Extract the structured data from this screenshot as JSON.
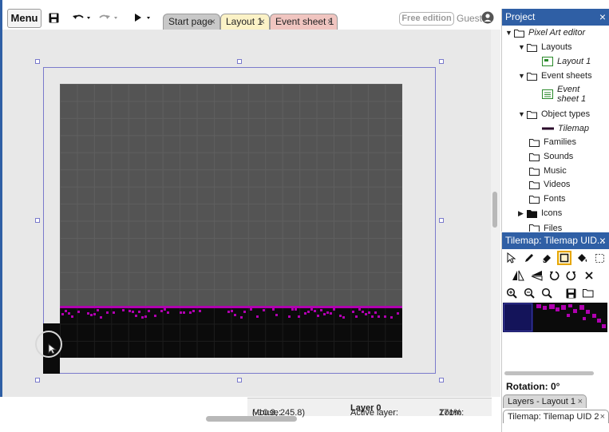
{
  "toolbar": {
    "menu_label": "Menu",
    "icons": [
      "save-icon",
      "undo-icon",
      "redo-icon",
      "play-icon"
    ],
    "edition_label": "Free edition",
    "guest_label": "Guest"
  },
  "tabs": [
    {
      "label": "Start page",
      "close": "×",
      "color": "#c8c8c8"
    },
    {
      "label": "Layout 1",
      "close": "×",
      "color": "#fbf2c6"
    },
    {
      "label": "Event sheet 1",
      "close": "×",
      "color": "#f0c5c0"
    }
  ],
  "status": {
    "mouse_label": "Mouse:",
    "mouse_value": "(-10.3, 245.8)",
    "layer_label": "Active layer:",
    "layer_value": "Layer 0",
    "zoom_label": "Zoom:",
    "zoom_value": "171%"
  },
  "project": {
    "title": "Project",
    "close": "×",
    "root": "Pixel Art editor",
    "layouts": "Layouts",
    "layout_1": "Layout 1",
    "event_sheets": "Event sheets",
    "event_sheet_1": "Event sheet 1",
    "object_types": "Object types",
    "tilemap": "Tilemap",
    "families": "Families",
    "sounds": "Sounds",
    "music": "Music",
    "videos": "Videos",
    "fonts": "Fonts",
    "icons": "Icons",
    "files": "Files"
  },
  "tilemap_panel": {
    "title": "Tilemap: Tilemap UID...",
    "close": "×",
    "tools": [
      "pointer-tool-icon",
      "pencil-tool-icon",
      "eraser-tool-icon",
      "rectangle-tool-icon",
      "fill-tool-icon",
      "selection-tool-icon",
      "mirror-icon",
      "flip-icon",
      "rotate-ccw-icon",
      "rotate-cw-icon",
      "reset-icon",
      "zoom-in-icon",
      "zoom-out-icon",
      "zoom-reset-icon",
      "save-tileset-icon",
      "open-tileset-icon"
    ],
    "rotation_label": "Rotation: 0°"
  },
  "bottom_tabs": [
    {
      "label": "Layers - Layout 1",
      "close": "×"
    },
    {
      "label": "Tilemap: Tilemap UID 2",
      "close": "×"
    }
  ],
  "colors": {
    "accent": "#2f5fa5",
    "grass": "#b000b0",
    "tile_background": "#545454",
    "tile_ground": "#0b0b0b",
    "selected_tool": "#e6a600"
  }
}
